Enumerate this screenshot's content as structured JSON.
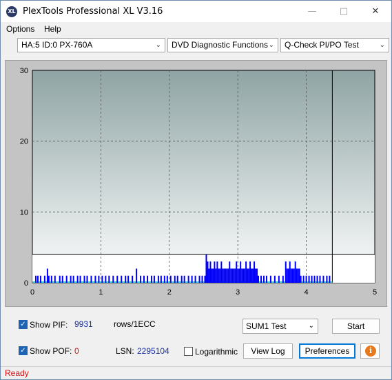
{
  "window": {
    "title": "PlexTools Professional XL V3.16",
    "icon_text": "XL"
  },
  "menu": {
    "options": "Options",
    "help": "Help"
  },
  "toolbar": {
    "drive": "HA:5 ID:0  PX-760A",
    "function": "DVD Diagnostic Functions",
    "test": "Q-Check PI/PO Test"
  },
  "chart_data": {
    "type": "bar",
    "title": "",
    "xlabel": "",
    "ylabel": "",
    "xlim": [
      0,
      5
    ],
    "ylim": [
      0,
      30
    ],
    "x_ticks": [
      "0",
      "1",
      "2",
      "3",
      "4",
      "5"
    ],
    "y_ticks": [
      "0",
      "10",
      "20",
      "30"
    ],
    "threshold_line": 4,
    "scan_end_x": 4.38,
    "grid": true,
    "colors": {
      "bars": "#0000ff",
      "po_trace": "#00c8c8",
      "bg_top": "#8fa4a4",
      "bg_bottom": "#ffffff"
    },
    "series": [
      {
        "name": "PIF",
        "x": [
          0.05,
          0.08,
          0.12,
          0.18,
          0.22,
          0.24,
          0.28,
          0.33,
          0.4,
          0.44,
          0.5,
          0.56,
          0.6,
          0.66,
          0.7,
          0.76,
          0.8,
          0.86,
          0.92,
          0.97,
          1.02,
          1.07,
          1.12,
          1.18,
          1.24,
          1.3,
          1.36,
          1.4,
          1.46,
          1.52,
          1.58,
          1.63,
          1.68,
          1.74,
          1.78,
          1.84,
          1.88,
          1.93,
          1.97,
          2.02,
          2.08,
          2.12,
          2.18,
          2.22,
          2.28,
          2.33,
          2.38,
          2.44,
          2.48,
          2.52,
          2.54,
          2.56,
          2.58,
          2.6,
          2.62,
          2.64,
          2.66,
          2.68,
          2.7,
          2.72,
          2.74,
          2.76,
          2.78,
          2.8,
          2.82,
          2.84,
          2.86,
          2.88,
          2.9,
          2.92,
          2.94,
          2.96,
          2.98,
          3.0,
          3.02,
          3.04,
          3.06,
          3.08,
          3.1,
          3.12,
          3.14,
          3.16,
          3.18,
          3.2,
          3.22,
          3.24,
          3.26,
          3.28,
          3.3,
          3.34,
          3.38,
          3.42,
          3.48,
          3.54,
          3.6,
          3.66,
          3.7,
          3.72,
          3.74,
          3.76,
          3.78,
          3.8,
          3.82,
          3.84,
          3.86,
          3.88,
          3.9,
          3.92,
          3.96,
          4.0,
          4.04,
          4.08,
          4.12,
          4.16,
          4.2,
          4.25,
          4.3,
          4.34
        ],
        "values": [
          1,
          1,
          1,
          1,
          2,
          1,
          1,
          1,
          1,
          1,
          1,
          1,
          1,
          1,
          1,
          1,
          1,
          1,
          1,
          1,
          1,
          1,
          1,
          1,
          1,
          1,
          1,
          1,
          1,
          2,
          1,
          1,
          1,
          1,
          1,
          1,
          1,
          1,
          1,
          1,
          1,
          1,
          1,
          1,
          1,
          1,
          1,
          1,
          1,
          1,
          4,
          3,
          2,
          3,
          2,
          2,
          3,
          2,
          3,
          2,
          2,
          3,
          2,
          2,
          2,
          2,
          2,
          3,
          2,
          2,
          2,
          2,
          3,
          2,
          2,
          3,
          2,
          2,
          2,
          3,
          2,
          2,
          3,
          2,
          2,
          3,
          2,
          2,
          1,
          1,
          1,
          1,
          1,
          1,
          1,
          1,
          3,
          2,
          2,
          3,
          2,
          2,
          2,
          3,
          2,
          2,
          2,
          1,
          1,
          1,
          1,
          1,
          1,
          1,
          1,
          1,
          1,
          1
        ]
      }
    ]
  },
  "controls": {
    "show_pif_label": "Show PIF:",
    "pif_value": "9931",
    "rows_unit": "rows/1ECC",
    "show_pof_label": "Show POF:",
    "pof_value": "0",
    "lsn_label": "LSN:",
    "lsn_value": "2295104",
    "logarithmic_label": "Logarithmic",
    "sum_test": "SUM1 Test",
    "start_button": "Start",
    "view_log_button": "View Log",
    "preferences_button": "Preferences"
  },
  "status": {
    "text": "Ready"
  }
}
